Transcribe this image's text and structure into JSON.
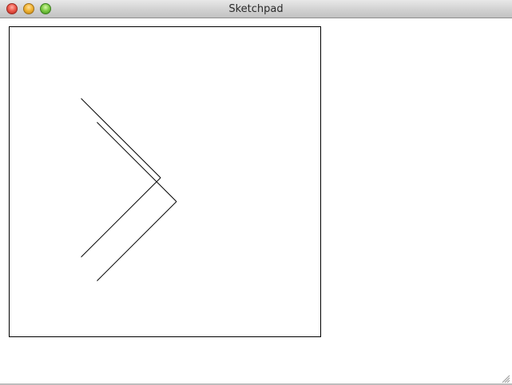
{
  "window": {
    "title": "Sketchpad"
  },
  "icons": {
    "close": "close-icon",
    "minimize": "minimize-icon",
    "zoom": "zoom-icon",
    "resize": "resize-grip-icon"
  },
  "colors": {
    "stroke": "#000000",
    "canvas_background": "#ffffff",
    "titlebar": "#d3d3d3"
  }
}
